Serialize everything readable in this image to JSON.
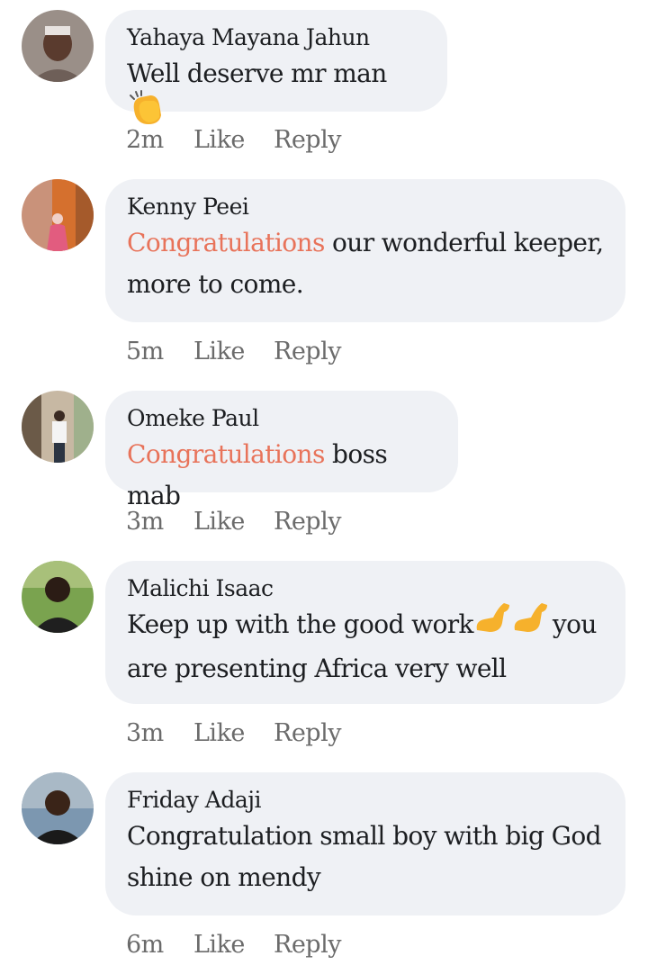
{
  "comments": [
    {
      "author": "Yahaya Mayana Jahun",
      "text_before": "",
      "highlight": "",
      "text_after": "Well deserve mr man",
      "emoji": "clapping-hands",
      "time": "2m",
      "like_label": "Like",
      "reply_label": "Reply"
    },
    {
      "author": "Kenny Peei",
      "highlight": "Congratulations",
      "text_after": " our wonderful keeper, more to come.",
      "time": "5m",
      "like_label": "Like",
      "reply_label": "Reply"
    },
    {
      "author": "Omeke Paul",
      "highlight": "Congratulations",
      "text_after": " boss mab",
      "time": "3m",
      "like_label": "Like",
      "reply_label": "Reply"
    },
    {
      "author": "Malichi Isaac",
      "text_part1": "Keep up with the good work",
      "emoji": "flexed-biceps",
      "text_part2": "you are presenting Africa very well",
      "time": "3m",
      "like_label": "Like",
      "reply_label": "Reply"
    },
    {
      "author": "Friday Adaji",
      "text_after": "Congratulation small boy with big God shine on mendy",
      "time": "6m",
      "like_label": "Like",
      "reply_label": "Reply"
    }
  ],
  "colors": {
    "bubble": "#eff1f5",
    "highlight": "#e8735a",
    "meta_text": "#6b6b6b"
  }
}
